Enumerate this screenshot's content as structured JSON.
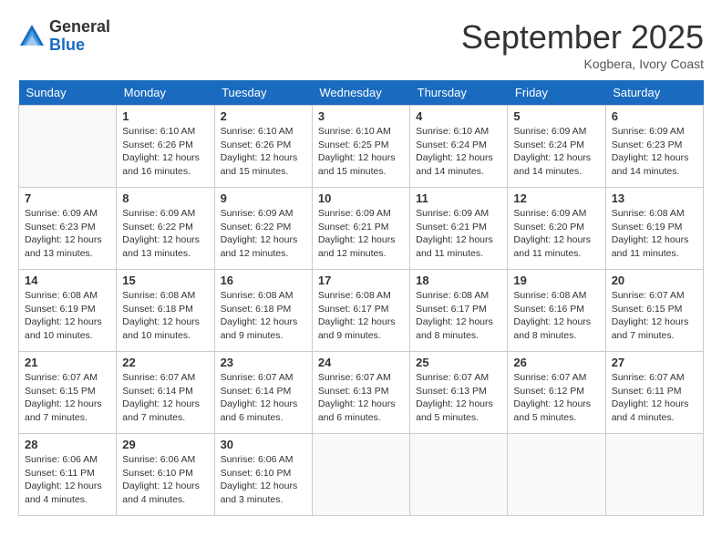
{
  "logo": {
    "general": "General",
    "blue": "Blue"
  },
  "title": "September 2025",
  "location": "Kogbera, Ivory Coast",
  "days_of_week": [
    "Sunday",
    "Monday",
    "Tuesday",
    "Wednesday",
    "Thursday",
    "Friday",
    "Saturday"
  ],
  "weeks": [
    [
      {
        "day": "",
        "info": ""
      },
      {
        "day": "1",
        "info": "Sunrise: 6:10 AM\nSunset: 6:26 PM\nDaylight: 12 hours\nand 16 minutes."
      },
      {
        "day": "2",
        "info": "Sunrise: 6:10 AM\nSunset: 6:26 PM\nDaylight: 12 hours\nand 15 minutes."
      },
      {
        "day": "3",
        "info": "Sunrise: 6:10 AM\nSunset: 6:25 PM\nDaylight: 12 hours\nand 15 minutes."
      },
      {
        "day": "4",
        "info": "Sunrise: 6:10 AM\nSunset: 6:24 PM\nDaylight: 12 hours\nand 14 minutes."
      },
      {
        "day": "5",
        "info": "Sunrise: 6:09 AM\nSunset: 6:24 PM\nDaylight: 12 hours\nand 14 minutes."
      },
      {
        "day": "6",
        "info": "Sunrise: 6:09 AM\nSunset: 6:23 PM\nDaylight: 12 hours\nand 14 minutes."
      }
    ],
    [
      {
        "day": "7",
        "info": "Sunrise: 6:09 AM\nSunset: 6:23 PM\nDaylight: 12 hours\nand 13 minutes."
      },
      {
        "day": "8",
        "info": "Sunrise: 6:09 AM\nSunset: 6:22 PM\nDaylight: 12 hours\nand 13 minutes."
      },
      {
        "day": "9",
        "info": "Sunrise: 6:09 AM\nSunset: 6:22 PM\nDaylight: 12 hours\nand 12 minutes."
      },
      {
        "day": "10",
        "info": "Sunrise: 6:09 AM\nSunset: 6:21 PM\nDaylight: 12 hours\nand 12 minutes."
      },
      {
        "day": "11",
        "info": "Sunrise: 6:09 AM\nSunset: 6:21 PM\nDaylight: 12 hours\nand 11 minutes."
      },
      {
        "day": "12",
        "info": "Sunrise: 6:09 AM\nSunset: 6:20 PM\nDaylight: 12 hours\nand 11 minutes."
      },
      {
        "day": "13",
        "info": "Sunrise: 6:08 AM\nSunset: 6:19 PM\nDaylight: 12 hours\nand 11 minutes."
      }
    ],
    [
      {
        "day": "14",
        "info": "Sunrise: 6:08 AM\nSunset: 6:19 PM\nDaylight: 12 hours\nand 10 minutes."
      },
      {
        "day": "15",
        "info": "Sunrise: 6:08 AM\nSunset: 6:18 PM\nDaylight: 12 hours\nand 10 minutes."
      },
      {
        "day": "16",
        "info": "Sunrise: 6:08 AM\nSunset: 6:18 PM\nDaylight: 12 hours\nand 9 minutes."
      },
      {
        "day": "17",
        "info": "Sunrise: 6:08 AM\nSunset: 6:17 PM\nDaylight: 12 hours\nand 9 minutes."
      },
      {
        "day": "18",
        "info": "Sunrise: 6:08 AM\nSunset: 6:17 PM\nDaylight: 12 hours\nand 8 minutes."
      },
      {
        "day": "19",
        "info": "Sunrise: 6:08 AM\nSunset: 6:16 PM\nDaylight: 12 hours\nand 8 minutes."
      },
      {
        "day": "20",
        "info": "Sunrise: 6:07 AM\nSunset: 6:15 PM\nDaylight: 12 hours\nand 7 minutes."
      }
    ],
    [
      {
        "day": "21",
        "info": "Sunrise: 6:07 AM\nSunset: 6:15 PM\nDaylight: 12 hours\nand 7 minutes."
      },
      {
        "day": "22",
        "info": "Sunrise: 6:07 AM\nSunset: 6:14 PM\nDaylight: 12 hours\nand 7 minutes."
      },
      {
        "day": "23",
        "info": "Sunrise: 6:07 AM\nSunset: 6:14 PM\nDaylight: 12 hours\nand 6 minutes."
      },
      {
        "day": "24",
        "info": "Sunrise: 6:07 AM\nSunset: 6:13 PM\nDaylight: 12 hours\nand 6 minutes."
      },
      {
        "day": "25",
        "info": "Sunrise: 6:07 AM\nSunset: 6:13 PM\nDaylight: 12 hours\nand 5 minutes."
      },
      {
        "day": "26",
        "info": "Sunrise: 6:07 AM\nSunset: 6:12 PM\nDaylight: 12 hours\nand 5 minutes."
      },
      {
        "day": "27",
        "info": "Sunrise: 6:07 AM\nSunset: 6:11 PM\nDaylight: 12 hours\nand 4 minutes."
      }
    ],
    [
      {
        "day": "28",
        "info": "Sunrise: 6:06 AM\nSunset: 6:11 PM\nDaylight: 12 hours\nand 4 minutes."
      },
      {
        "day": "29",
        "info": "Sunrise: 6:06 AM\nSunset: 6:10 PM\nDaylight: 12 hours\nand 4 minutes."
      },
      {
        "day": "30",
        "info": "Sunrise: 6:06 AM\nSunset: 6:10 PM\nDaylight: 12 hours\nand 3 minutes."
      },
      {
        "day": "",
        "info": ""
      },
      {
        "day": "",
        "info": ""
      },
      {
        "day": "",
        "info": ""
      },
      {
        "day": "",
        "info": ""
      }
    ]
  ]
}
